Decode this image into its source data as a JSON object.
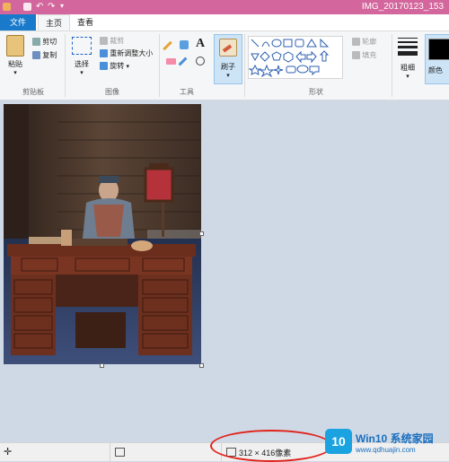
{
  "window": {
    "title": "IMG_20170123_153"
  },
  "tabs": [
    {
      "label": "文件"
    },
    {
      "label": "主页"
    },
    {
      "label": "查看"
    }
  ],
  "clipboard": {
    "paste": "粘贴",
    "cut": "剪切",
    "copy": "复制",
    "group": "剪贴板"
  },
  "image": {
    "select": "选择",
    "crop": "裁剪",
    "resize": "重新调整大小",
    "rotate": "旋转",
    "group": "图像"
  },
  "tools": {
    "group": "工具"
  },
  "brushes": {
    "label": "刷子"
  },
  "shapes": {
    "outline": "轮廓",
    "fill": "填充",
    "group": "形状"
  },
  "size": {
    "label": "粗细"
  },
  "colors": {
    "label": "颜色"
  },
  "status": {
    "dimensions": "312 × 416像素"
  },
  "watermark": {
    "logo": "10",
    "title": "Win10 系统家园",
    "url": "www.qdhuajin.com"
  }
}
